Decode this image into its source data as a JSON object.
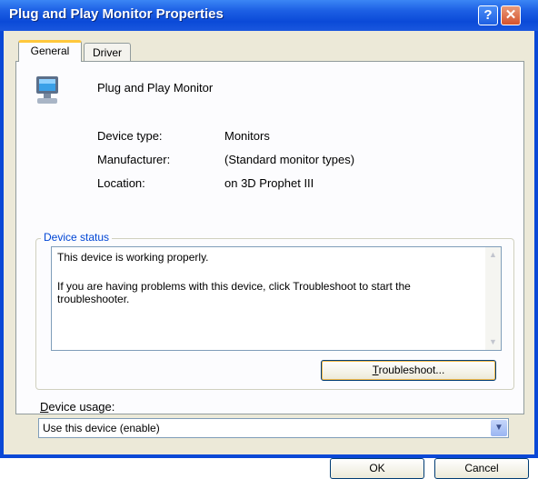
{
  "window": {
    "title": "Plug and Play Monitor Properties"
  },
  "titlebar_buttons": {
    "help": "?",
    "close": "✕"
  },
  "tabs": [
    {
      "label": "General",
      "active": true
    },
    {
      "label": "Driver",
      "active": false
    }
  ],
  "device": {
    "icon": "monitor-icon",
    "name": "Plug and Play Monitor",
    "properties": [
      {
        "label": "Device type:",
        "value": "Monitors"
      },
      {
        "label": "Manufacturer:",
        "value": "(Standard monitor types)"
      },
      {
        "label": "Location:",
        "value": "on 3D Prophet III"
      }
    ]
  },
  "status": {
    "group_label": "Device status",
    "line1": "This device is working properly.",
    "line2": "If you are having problems with this device, click Troubleshoot to start the troubleshooter."
  },
  "buttons": {
    "troubleshoot_first": "T",
    "troubleshoot_rest": "roubleshoot...",
    "ok": "OK",
    "cancel": "Cancel"
  },
  "usage": {
    "label_first": "D",
    "label_rest": "evice usage:",
    "selected": "Use this device (enable)"
  },
  "colors": {
    "titlebar": "#0b4ad8",
    "dialog_bg": "#ece9d8",
    "group_label": "#0046d5"
  }
}
